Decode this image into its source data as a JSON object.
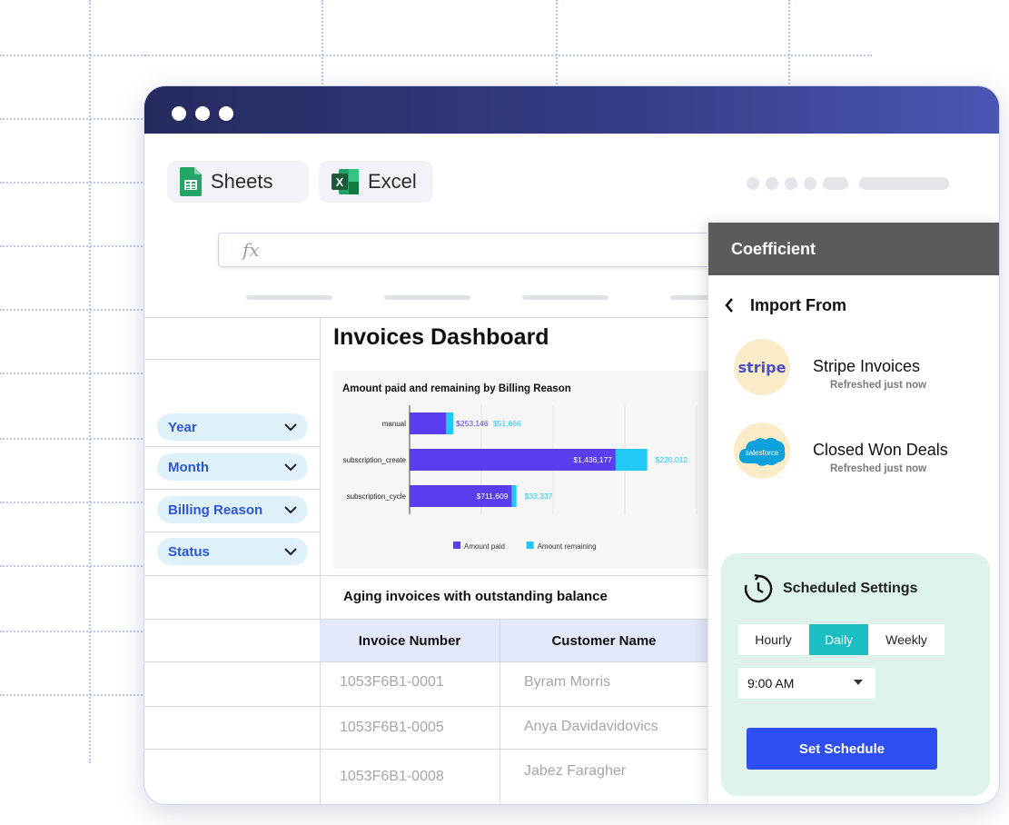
{
  "apps": {
    "sheets_label": "Sheets",
    "excel_label": "Excel"
  },
  "formula_bar": {
    "fx_label": "fx"
  },
  "dashboard": {
    "title": "Invoices Dashboard"
  },
  "filters": [
    {
      "label": "Year"
    },
    {
      "label": "Month"
    },
    {
      "label": "Billing Reason"
    },
    {
      "label": "Status"
    }
  ],
  "chart_data": {
    "type": "bar",
    "stacked": true,
    "orientation": "horizontal",
    "title": "Amount paid and remaining by Billing Reason",
    "categories": [
      "manual",
      "subscription_create",
      "subscription_cycle"
    ],
    "series": [
      {
        "name": "Amount paid",
        "values": [
          253146,
          1436177,
          711609
        ],
        "labels": [
          "$253,146",
          "$1,436,177",
          "$711,609"
        ],
        "color": "#5b3df0"
      },
      {
        "name": "Amount remaining",
        "values": [
          51666,
          220012,
          33337
        ],
        "labels": [
          "$51,666",
          "$220,012",
          "$33,337"
        ],
        "color": "#22c8f5"
      }
    ],
    "xlim": [
      0,
      2000000
    ],
    "grid": true,
    "legend_position": "bottom"
  },
  "aging": {
    "title": "Aging invoices with outstanding balance",
    "headers": [
      "Invoice Number",
      "Customer Name"
    ],
    "rows": [
      [
        "1053F6B1-0001",
        "Byram Morris"
      ],
      [
        "1053F6B1-0005",
        "Anya Davidavidovics"
      ],
      [
        "1053F6B1-0008",
        "Jabez Faragher"
      ]
    ]
  },
  "panel": {
    "title": "Coefficient",
    "import_title": "Import From",
    "sources": [
      {
        "name": "Stripe Invoices",
        "status": "Refreshed just now",
        "logo_text": "stripe",
        "icon": "stripe-logo"
      },
      {
        "name": "Closed Won Deals",
        "status": "Refreshed just now",
        "logo_text": "salesforce",
        "icon": "salesforce-logo"
      }
    ],
    "schedule": {
      "title": "Scheduled Settings",
      "frequencies": [
        "Hourly",
        "Daily",
        "Weekly"
      ],
      "active_frequency": "Daily",
      "time": "9:00 AM",
      "button_label": "Set Schedule"
    }
  },
  "colors": {
    "titlebar_start": "#252a5e",
    "titlebar_end": "#4a56b4",
    "filter_bg": "#dff1fb",
    "filter_text": "#2c55d7",
    "active_freq": "#19bfc2",
    "primary_button": "#2d4ff2",
    "schedule_card": "#ddf3ec"
  }
}
